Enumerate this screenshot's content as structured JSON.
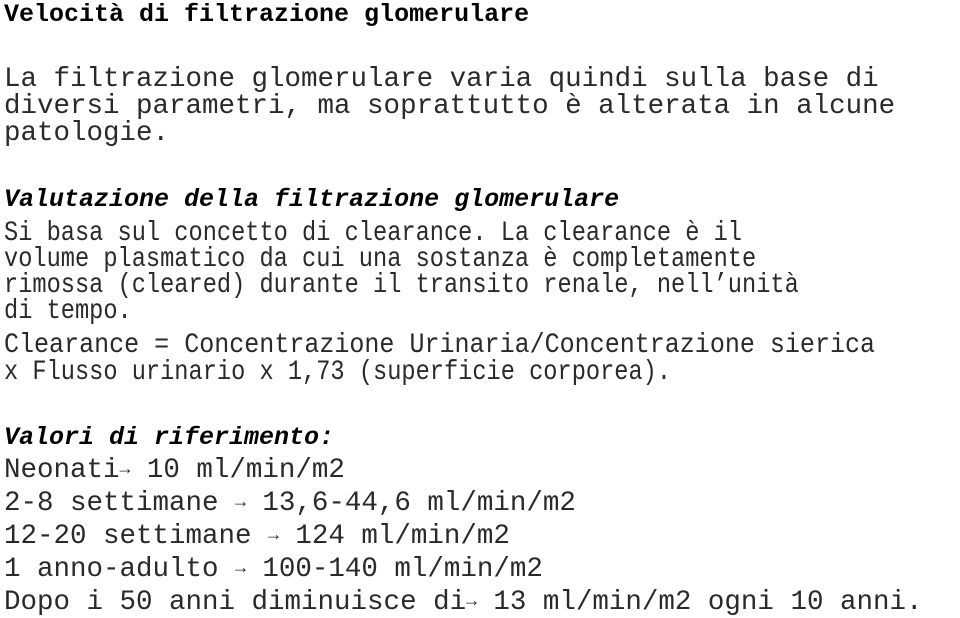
{
  "title": "Velocità di filtrazione glomerulare",
  "intro": [
    "La filtrazione glomerulare varia quindi sulla base di",
    "diversi parametri, ma soprattutto è alterata in alcune",
    "patologie."
  ],
  "section_evaluation": {
    "heading": "Valutazione della filtrazione glomerulare",
    "paragraph": [
      "Si basa sul concetto di clearance. La clearance è il",
      "volume plasmatico da cui una sostanza è completamente",
      "rimossa (cleared) durante il transito renale, nell’unità",
      "di tempo."
    ],
    "formula": [
      "Clearance = Concentrazione Urinaria/Concentrazione sierica",
      "x Flusso urinario x 1,73 (superficie corporea)."
    ]
  },
  "section_reference": {
    "heading": "Valori di riferimento:",
    "arrow_icon": "→",
    "items": [
      {
        "label": "Neonati",
        "sep": "",
        "value": " 10 ml/min/m2"
      },
      {
        "label": "2-8 settimane",
        "sep": " ",
        "value": " 13,6-44,6 ml/min/m2"
      },
      {
        "label": "12-20 settimane",
        "sep": " ",
        "value": " 124 ml/min/m2"
      },
      {
        "label": "1 anno-adulto",
        "sep": " ",
        "value": " 100-140 ml/min/m2"
      },
      {
        "label": "Dopo i 50 anni diminuisce di",
        "sep": "",
        "value": " 13 ml/min/m2 ogni 10 anni."
      }
    ]
  }
}
